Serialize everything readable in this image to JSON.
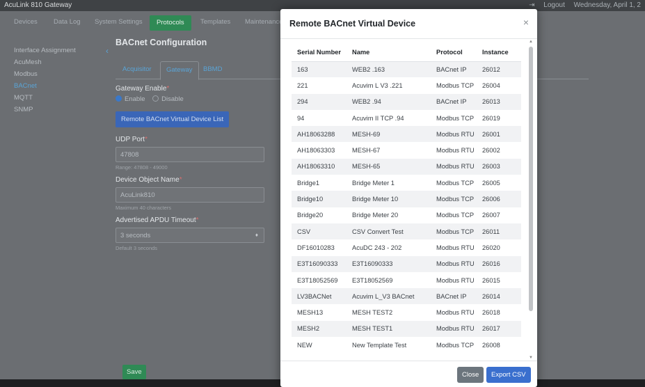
{
  "window": {
    "title": "AcuLink 810 Gateway",
    "logout_label": "Logout",
    "date": "Wednesday, April 1, 2"
  },
  "nav": {
    "devices": "Devices",
    "data_log": "Data Log",
    "system_settings": "System Settings",
    "protocols": "Protocols",
    "templates": "Templates",
    "maintenance": "Maintenance"
  },
  "sidebar": {
    "items": [
      "Interface Assignment",
      "AcuMesh",
      "Modbus",
      "BACnet",
      "MQTT",
      "SNMP"
    ]
  },
  "page": {
    "title": "BACnet Configuration",
    "tabs": [
      "Acquisitor",
      "Gateway",
      "BBMD"
    ],
    "gateway_enable_label": "Gateway Enable",
    "enable_label": "Enable",
    "disable_label": "Disable",
    "remote_list_button": "Remote BACnet Virtual Device List",
    "udp_port_label": "UDP Port",
    "udp_port_value": "47808",
    "udp_port_hint": "Range: 47808 - 49000",
    "device_object_name_label": "Device Object Name",
    "device_object_name_value": "AcuLink810",
    "device_object_name_hint": "Maximum 40 characters",
    "apdu_timeout_label": "Advertised APDU Timeout",
    "apdu_timeout_value": "3 seconds",
    "apdu_timeout_hint": "Default 3 seconds",
    "save_button": "Save"
  },
  "modal": {
    "title": "Remote BACnet Virtual Device",
    "close_icon": "close-icon",
    "columns": [
      "Serial Number",
      "Name",
      "Protocol",
      "Instance"
    ],
    "rows": [
      [
        "163",
        "WEB2 .163",
        "BACnet IP",
        "26012"
      ],
      [
        "221",
        "Acuvim L V3 .221",
        "Modbus TCP",
        "26004"
      ],
      [
        "294",
        "WEB2 .94",
        "BACnet IP",
        "26013"
      ],
      [
        "94",
        "Acuvim II TCP .94",
        "Modbus TCP",
        "26019"
      ],
      [
        "AH18063288",
        "MESH-69",
        "Modbus RTU",
        "26001"
      ],
      [
        "AH18063303",
        "MESH-67",
        "Modbus RTU",
        "26002"
      ],
      [
        "AH18063310",
        "MESH-65",
        "Modbus RTU",
        "26003"
      ],
      [
        "Bridge1",
        "Bridge Meter 1",
        "Modbus TCP",
        "26005"
      ],
      [
        "Bridge10",
        "Bridge Meter 10",
        "Modbus TCP",
        "26006"
      ],
      [
        "Bridge20",
        "Bridge Meter 20",
        "Modbus TCP",
        "26007"
      ],
      [
        "CSV",
        "CSV Convert Test",
        "Modbus TCP",
        "26011"
      ],
      [
        "DF16010283",
        "AcuDC 243 - 202",
        "Modbus RTU",
        "26020"
      ],
      [
        "E3T16090333",
        "E3T16090333",
        "Modbus RTU",
        "26016"
      ],
      [
        "E3T18052569",
        "E3T18052569",
        "Modbus RTU",
        "26015"
      ],
      [
        "LV3BACNet",
        "Acuvim L_V3 BACnet",
        "BACnet IP",
        "26014"
      ],
      [
        "MESH13",
        "MESH TEST2",
        "Modbus RTU",
        "26018"
      ],
      [
        "MESH2",
        "MESH TEST1",
        "Modbus RTU",
        "26017"
      ],
      [
        "NEW",
        "New Template Test",
        "Modbus TCP",
        "26008"
      ]
    ],
    "close_button": "Close",
    "export_button": "Export CSV"
  }
}
